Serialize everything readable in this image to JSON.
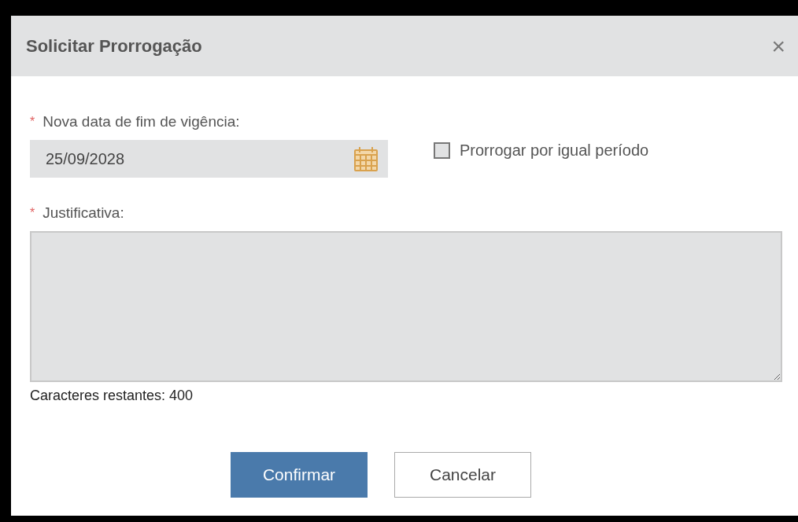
{
  "dialog": {
    "title": "Solicitar Prorrogação",
    "close": "×"
  },
  "date_field": {
    "required_mark": "*",
    "label": "Nova data de fim de vigência:",
    "value": "25/09/2028"
  },
  "same_period": {
    "label": "Prorrogar por igual período",
    "checked": false
  },
  "justification": {
    "required_mark": "*",
    "label": "Justificativa:"
  },
  "char_counter": "Caracteres restantes: 400",
  "buttons": [
    {
      "label": "Confirmar",
      "kind": "primary"
    },
    {
      "label": "Cancelar",
      "kind": "secondary"
    }
  ]
}
